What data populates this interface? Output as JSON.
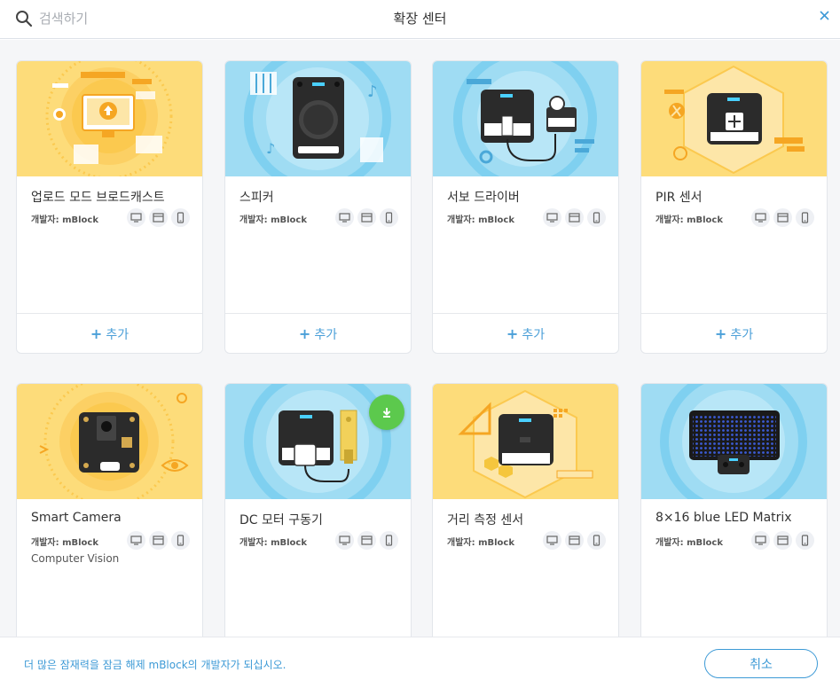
{
  "header": {
    "search_placeholder": "검색하기",
    "title": "확장 센터",
    "close_label": "X"
  },
  "cards": [
    {
      "name": "업로드 모드 브로드캐스트",
      "developer": "개발자: mBlock",
      "description": "",
      "add_label": "추가",
      "thumb_bg": "#fddc7a",
      "icon": "monitor-upload-icon"
    },
    {
      "name": "스피커",
      "developer": "개발자: mBlock",
      "description": "",
      "add_label": "추가",
      "thumb_bg": "#9fdcf3",
      "icon": "speaker-module-icon"
    },
    {
      "name": "서보 드라이버",
      "developer": "개발자: mBlock",
      "description": "",
      "add_label": "추가",
      "thumb_bg": "#9fdcf3",
      "icon": "servo-module-icon"
    },
    {
      "name": "PIR 센서",
      "developer": "개발자: mBlock",
      "description": "",
      "add_label": "추가",
      "thumb_bg": "#fddc7a",
      "icon": "pir-module-icon"
    },
    {
      "name": "Smart Camera",
      "developer": "개발자: mBlock",
      "description": "Computer Vision",
      "add_label": "",
      "thumb_bg": "#fddc7a",
      "icon": "camera-board-icon"
    },
    {
      "name": "DC 모터 구동기",
      "developer": "개발자: mBlock",
      "description": "",
      "add_label": "",
      "thumb_bg": "#9fdcf3",
      "icon": "dc-motor-module-icon"
    },
    {
      "name": "거리 측정 센서",
      "developer": "개발자: mBlock",
      "description": "",
      "add_label": "",
      "thumb_bg": "#fddc7a",
      "icon": "ranging-module-icon"
    },
    {
      "name": "8×16 blue LED Matrix",
      "developer": "개발자: mBlock",
      "description": "",
      "add_label": "",
      "thumb_bg": "#9fdcf3",
      "icon": "led-matrix-icon"
    }
  ],
  "platform_icons": [
    "desktop-icon",
    "browser-icon",
    "mobile-icon"
  ],
  "footer": {
    "promo_text": "더 많은 잠재력을 잠금 해제 mBlock의 개발자가 되십시오.",
    "cancel_label": "취소"
  },
  "colors": {
    "accent": "#3d9ad6",
    "download_badge": "#5cc94d",
    "yellow_thumb": "#fddc7a",
    "blue_thumb": "#9fdcf3"
  }
}
